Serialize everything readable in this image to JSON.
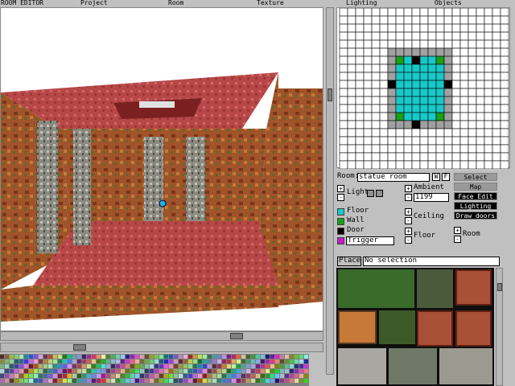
{
  "menu": {
    "title": "ROOM EDITOR",
    "project": "Project",
    "room": "Room",
    "texture": "Texture",
    "lighting": "Lighting",
    "objects": "Objects"
  },
  "room": {
    "label": "Room:",
    "name_value": "statue room",
    "btn_w": "W",
    "btn_f": "F"
  },
  "lighting_controls": {
    "light_label": "Light",
    "ambient_label": "Ambient",
    "ambient_value": "1199",
    "plus": "+",
    "minus": "-"
  },
  "legend": [
    {
      "label": "Floor",
      "color": "#18c8c8"
    },
    {
      "label": "Wall",
      "color": "#18a018"
    },
    {
      "label": "Door",
      "color": "#000000"
    },
    {
      "label": "Trigger",
      "color": "#c818c8"
    }
  ],
  "height_controls": {
    "ceiling_label": "Ceiling",
    "floor_label": "Floor",
    "room_label": "Room"
  },
  "modes": [
    {
      "label": "Select",
      "selected": true
    },
    {
      "label": "Map",
      "selected": true
    },
    {
      "label": "Face Edit",
      "selected": false
    },
    {
      "label": "Lighting",
      "selected": false
    },
    {
      "label": "Draw doors",
      "selected": false
    }
  ],
  "place": {
    "button_label": "Place",
    "status": "No selection"
  },
  "colors": {
    "floor_cell": "#18c8c8",
    "wall_corner": "#18a018",
    "door_cell": "#000000",
    "frame_cell": "#a0a0a0",
    "floor_red": "#b84848",
    "wall_brown": "#a0542a"
  }
}
